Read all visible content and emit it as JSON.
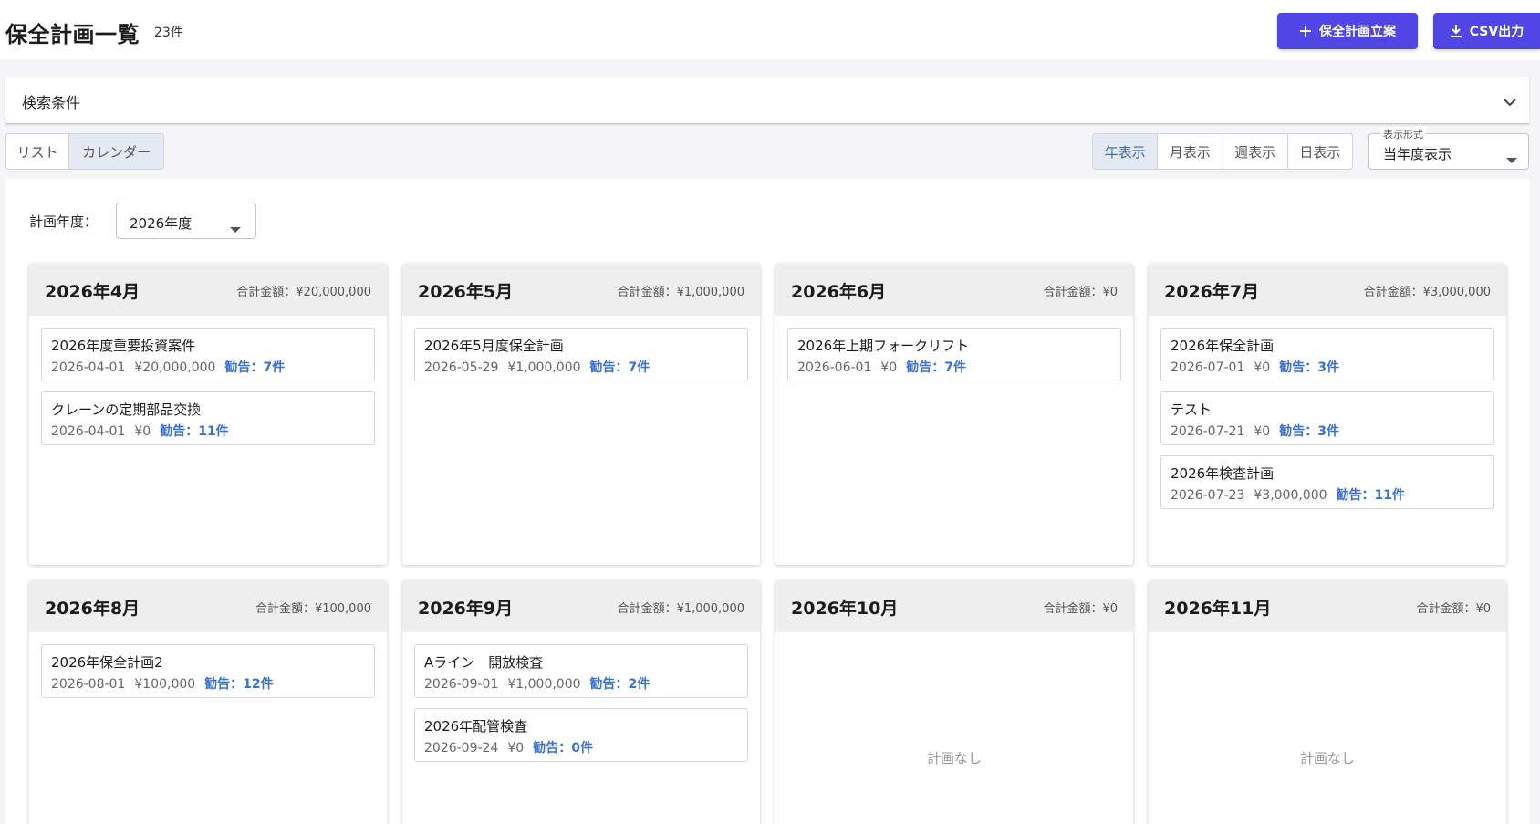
{
  "header": {
    "title": "保全計画一覧",
    "count": "23件",
    "plan_button": "保全計画立案",
    "csv_button": "CSV出力"
  },
  "search": {
    "title": "検索条件"
  },
  "view_toggle": {
    "list": "リスト",
    "calendar": "カレンダー",
    "selected": "カレンダー"
  },
  "period_toggle": {
    "year": "年表示",
    "month": "月表示",
    "week": "週表示",
    "day": "日表示",
    "selected": "年表示"
  },
  "display_format": {
    "label": "表示形式",
    "value": "当年度表示"
  },
  "fiscal_year": {
    "label": "計画年度：",
    "value": "2026年度"
  },
  "colors": {
    "primary": "#4f46e5",
    "advice": "#3b6fd1",
    "selected_bg": "#e4e9f3"
  },
  "months": [
    {
      "name": "2026年4月",
      "total": "合計金額：¥20,000,000",
      "plans": [
        {
          "title": "2026年度重要投資案件",
          "date": "2026-04-01",
          "amount": "¥20,000,000",
          "advice": "勧告：7件"
        },
        {
          "title": "クレーンの定期部品交換",
          "date": "2026-04-01",
          "amount": "¥0",
          "advice": "勧告：11件"
        }
      ]
    },
    {
      "name": "2026年5月",
      "total": "合計金額：¥1,000,000",
      "plans": [
        {
          "title": "2026年5月度保全計画",
          "date": "2026-05-29",
          "amount": "¥1,000,000",
          "advice": "勧告：7件"
        }
      ]
    },
    {
      "name": "2026年6月",
      "total": "合計金額：¥0",
      "plans": [
        {
          "title": "2026年上期フォークリフト",
          "date": "2026-06-01",
          "amount": "¥0",
          "advice": "勧告：7件"
        }
      ]
    },
    {
      "name": "2026年7月",
      "total": "合計金額：¥3,000,000",
      "plans": [
        {
          "title": "2026年保全計画",
          "date": "2026-07-01",
          "amount": "¥0",
          "advice": "勧告：3件"
        },
        {
          "title": "テスト",
          "date": "2026-07-21",
          "amount": "¥0",
          "advice": "勧告：3件"
        },
        {
          "title": "2026年検査計画",
          "date": "2026-07-23",
          "amount": "¥3,000,000",
          "advice": "勧告：11件"
        }
      ]
    },
    {
      "name": "2026年8月",
      "total": "合計金額：¥100,000",
      "plans": [
        {
          "title": "2026年保全計画2",
          "date": "2026-08-01",
          "amount": "¥100,000",
          "advice": "勧告：12件"
        }
      ]
    },
    {
      "name": "2026年9月",
      "total": "合計金額：¥1,000,000",
      "plans": [
        {
          "title": "Aライン　開放検査",
          "date": "2026-09-01",
          "amount": "¥1,000,000",
          "advice": "勧告：2件"
        },
        {
          "title": "2026年配管検査",
          "date": "2026-09-24",
          "amount": "¥0",
          "advice": "勧告：0件"
        }
      ]
    },
    {
      "name": "2026年10月",
      "total": "合計金額：¥0",
      "plans": [],
      "empty": "計画なし"
    },
    {
      "name": "2026年11月",
      "total": "合計金額：¥0",
      "plans": [],
      "empty": "計画なし"
    }
  ]
}
